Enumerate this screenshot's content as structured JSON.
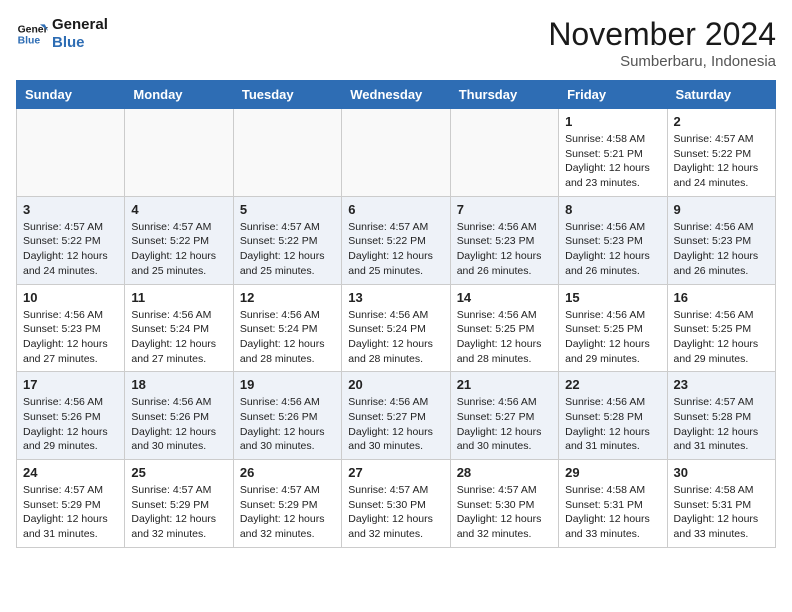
{
  "header": {
    "logo_line1": "General",
    "logo_line2": "Blue",
    "month": "November 2024",
    "location": "Sumberbaru, Indonesia"
  },
  "days_of_week": [
    "Sunday",
    "Monday",
    "Tuesday",
    "Wednesday",
    "Thursday",
    "Friday",
    "Saturday"
  ],
  "weeks": [
    [
      {
        "num": "",
        "info": ""
      },
      {
        "num": "",
        "info": ""
      },
      {
        "num": "",
        "info": ""
      },
      {
        "num": "",
        "info": ""
      },
      {
        "num": "",
        "info": ""
      },
      {
        "num": "1",
        "info": "Sunrise: 4:58 AM\nSunset: 5:21 PM\nDaylight: 12 hours\nand 23 minutes."
      },
      {
        "num": "2",
        "info": "Sunrise: 4:57 AM\nSunset: 5:22 PM\nDaylight: 12 hours\nand 24 minutes."
      }
    ],
    [
      {
        "num": "3",
        "info": "Sunrise: 4:57 AM\nSunset: 5:22 PM\nDaylight: 12 hours\nand 24 minutes."
      },
      {
        "num": "4",
        "info": "Sunrise: 4:57 AM\nSunset: 5:22 PM\nDaylight: 12 hours\nand 25 minutes."
      },
      {
        "num": "5",
        "info": "Sunrise: 4:57 AM\nSunset: 5:22 PM\nDaylight: 12 hours\nand 25 minutes."
      },
      {
        "num": "6",
        "info": "Sunrise: 4:57 AM\nSunset: 5:22 PM\nDaylight: 12 hours\nand 25 minutes."
      },
      {
        "num": "7",
        "info": "Sunrise: 4:56 AM\nSunset: 5:23 PM\nDaylight: 12 hours\nand 26 minutes."
      },
      {
        "num": "8",
        "info": "Sunrise: 4:56 AM\nSunset: 5:23 PM\nDaylight: 12 hours\nand 26 minutes."
      },
      {
        "num": "9",
        "info": "Sunrise: 4:56 AM\nSunset: 5:23 PM\nDaylight: 12 hours\nand 26 minutes."
      }
    ],
    [
      {
        "num": "10",
        "info": "Sunrise: 4:56 AM\nSunset: 5:23 PM\nDaylight: 12 hours\nand 27 minutes."
      },
      {
        "num": "11",
        "info": "Sunrise: 4:56 AM\nSunset: 5:24 PM\nDaylight: 12 hours\nand 27 minutes."
      },
      {
        "num": "12",
        "info": "Sunrise: 4:56 AM\nSunset: 5:24 PM\nDaylight: 12 hours\nand 28 minutes."
      },
      {
        "num": "13",
        "info": "Sunrise: 4:56 AM\nSunset: 5:24 PM\nDaylight: 12 hours\nand 28 minutes."
      },
      {
        "num": "14",
        "info": "Sunrise: 4:56 AM\nSunset: 5:25 PM\nDaylight: 12 hours\nand 28 minutes."
      },
      {
        "num": "15",
        "info": "Sunrise: 4:56 AM\nSunset: 5:25 PM\nDaylight: 12 hours\nand 29 minutes."
      },
      {
        "num": "16",
        "info": "Sunrise: 4:56 AM\nSunset: 5:25 PM\nDaylight: 12 hours\nand 29 minutes."
      }
    ],
    [
      {
        "num": "17",
        "info": "Sunrise: 4:56 AM\nSunset: 5:26 PM\nDaylight: 12 hours\nand 29 minutes."
      },
      {
        "num": "18",
        "info": "Sunrise: 4:56 AM\nSunset: 5:26 PM\nDaylight: 12 hours\nand 30 minutes."
      },
      {
        "num": "19",
        "info": "Sunrise: 4:56 AM\nSunset: 5:26 PM\nDaylight: 12 hours\nand 30 minutes."
      },
      {
        "num": "20",
        "info": "Sunrise: 4:56 AM\nSunset: 5:27 PM\nDaylight: 12 hours\nand 30 minutes."
      },
      {
        "num": "21",
        "info": "Sunrise: 4:56 AM\nSunset: 5:27 PM\nDaylight: 12 hours\nand 30 minutes."
      },
      {
        "num": "22",
        "info": "Sunrise: 4:56 AM\nSunset: 5:28 PM\nDaylight: 12 hours\nand 31 minutes."
      },
      {
        "num": "23",
        "info": "Sunrise: 4:57 AM\nSunset: 5:28 PM\nDaylight: 12 hours\nand 31 minutes."
      }
    ],
    [
      {
        "num": "24",
        "info": "Sunrise: 4:57 AM\nSunset: 5:29 PM\nDaylight: 12 hours\nand 31 minutes."
      },
      {
        "num": "25",
        "info": "Sunrise: 4:57 AM\nSunset: 5:29 PM\nDaylight: 12 hours\nand 32 minutes."
      },
      {
        "num": "26",
        "info": "Sunrise: 4:57 AM\nSunset: 5:29 PM\nDaylight: 12 hours\nand 32 minutes."
      },
      {
        "num": "27",
        "info": "Sunrise: 4:57 AM\nSunset: 5:30 PM\nDaylight: 12 hours\nand 32 minutes."
      },
      {
        "num": "28",
        "info": "Sunrise: 4:57 AM\nSunset: 5:30 PM\nDaylight: 12 hours\nand 32 minutes."
      },
      {
        "num": "29",
        "info": "Sunrise: 4:58 AM\nSunset: 5:31 PM\nDaylight: 12 hours\nand 33 minutes."
      },
      {
        "num": "30",
        "info": "Sunrise: 4:58 AM\nSunset: 5:31 PM\nDaylight: 12 hours\nand 33 minutes."
      }
    ]
  ]
}
